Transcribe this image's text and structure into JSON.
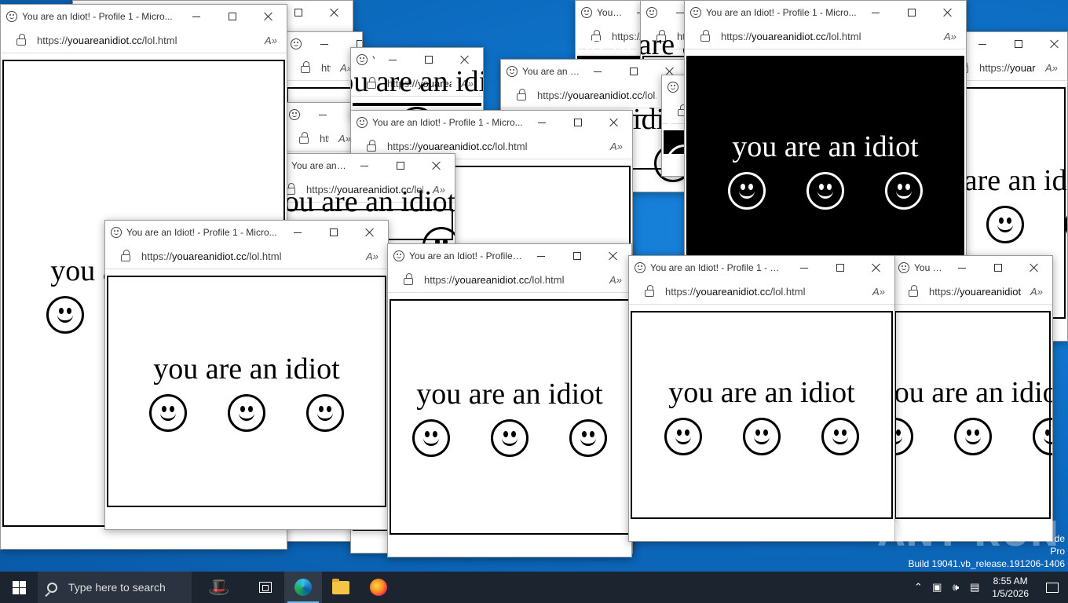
{
  "browser": {
    "title": "You are an Idiot! - Profile 1 - Micro...",
    "url_prefix": "https://",
    "url_domain": "youareanidiot.cc",
    "url_path": "/lol.html",
    "url_full": "https://youareanidiot.cc/lol.html",
    "read_aloud_glyph": "A⁾",
    "minimize_label": "Minimize",
    "maximize_label": "Maximize",
    "close_label": "Close"
  },
  "page": {
    "message": "you are an idiot"
  },
  "windows": [
    {
      "id": "w01",
      "variant": "white"
    },
    {
      "id": "w02",
      "variant": "white"
    },
    {
      "id": "w03",
      "variant": "black"
    },
    {
      "id": "w04",
      "variant": "white"
    },
    {
      "id": "w05",
      "variant": "white"
    },
    {
      "id": "w06",
      "variant": "black"
    },
    {
      "id": "w07",
      "variant": "white"
    },
    {
      "id": "w08",
      "variant": "black"
    },
    {
      "id": "w09",
      "variant": "white"
    },
    {
      "id": "w10",
      "variant": "white"
    },
    {
      "id": "w11",
      "variant": "white"
    },
    {
      "id": "w12",
      "variant": "white"
    },
    {
      "id": "w13",
      "variant": "black"
    },
    {
      "id": "w14",
      "variant": "white"
    },
    {
      "id": "w15",
      "variant": "white"
    },
    {
      "id": "w16",
      "variant": "white"
    }
  ],
  "taskbar": {
    "search_placeholder": "Type here to search",
    "time": "8:55 AM",
    "date": "1/5/2026",
    "pinned": [
      "task-view",
      "microsoft-edge",
      "file-explorer",
      "firefox"
    ],
    "active_app": "microsoft-edge"
  },
  "watermark": {
    "brand": "ANY RUN",
    "line1": "de",
    "line2": "Pro",
    "line3": "Build 19041.vb_release.191206-1406"
  },
  "colors": {
    "desktop": "#0d6fc4",
    "taskbar": "#1c2430",
    "accent": "#76b9ed"
  }
}
